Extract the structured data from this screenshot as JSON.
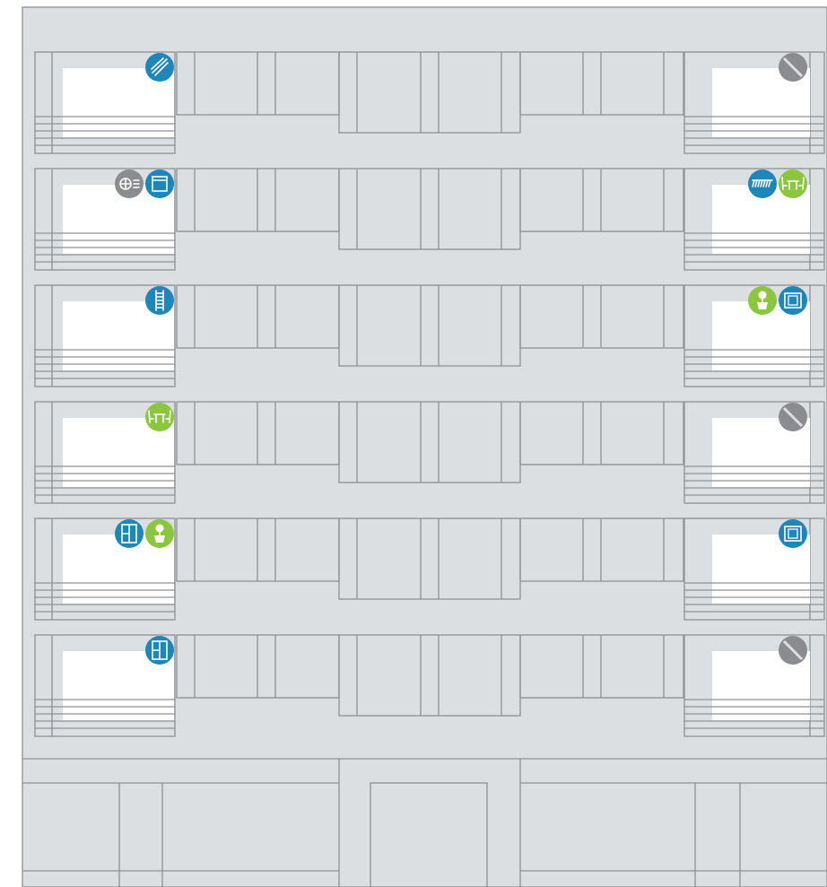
{
  "colors": {
    "background": "#ffffff",
    "facade_fill": "#dcdfe1",
    "line": "#8e9093",
    "window_white": "#ffffff",
    "blue": "#1f86b9",
    "green": "#8cc63f",
    "gray": "#8a8c8f",
    "icon_white": "#ffffff"
  },
  "floors": [
    {
      "left_icons": [
        {
          "name": "clothes-drying-icon",
          "color": "blue"
        }
      ],
      "right_icons": [
        {
          "name": "not-available-icon",
          "color": "gray"
        }
      ]
    },
    {
      "left_icons": [
        {
          "name": "air-conditioner-icon",
          "color": "gray"
        },
        {
          "name": "storage-unit-icon",
          "color": "blue"
        }
      ],
      "right_icons": [
        {
          "name": "awning-icon",
          "color": "blue"
        },
        {
          "name": "outdoor-furniture-icon",
          "color": "green"
        }
      ]
    },
    {
      "left_icons": [
        {
          "name": "ladder-icon",
          "color": "blue"
        }
      ],
      "right_icons": [
        {
          "name": "potted-plant-icon",
          "color": "green"
        },
        {
          "name": "window-frame-icon",
          "color": "blue"
        }
      ]
    },
    {
      "left_icons": [
        {
          "name": "outdoor-furniture-icon",
          "color": "green"
        }
      ],
      "right_icons": [
        {
          "name": "not-available-icon",
          "color": "gray"
        }
      ]
    },
    {
      "left_icons": [
        {
          "name": "cabinet-icon",
          "color": "blue"
        },
        {
          "name": "potted-plant-icon",
          "color": "green"
        }
      ],
      "right_icons": [
        {
          "name": "window-frame-icon",
          "color": "blue"
        }
      ]
    },
    {
      "left_icons": [
        {
          "name": "cabinet-icon",
          "color": "blue"
        }
      ],
      "right_icons": [
        {
          "name": "not-available-icon",
          "color": "gray"
        }
      ]
    }
  ]
}
